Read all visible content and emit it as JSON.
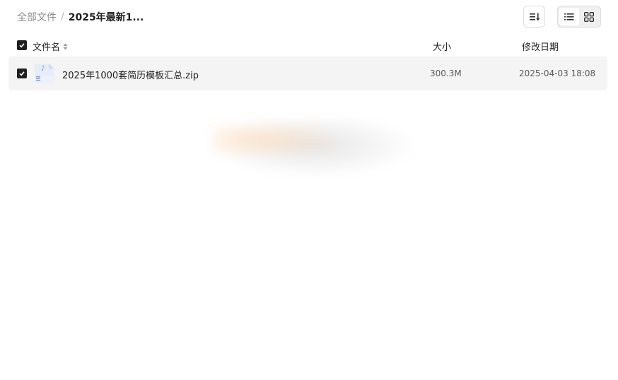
{
  "breadcrumb": {
    "root": "全部文件",
    "separator": "/",
    "current": "2025年最新1..."
  },
  "toolbar": {
    "sort_icon": "sort-list-icon",
    "view_list_icon": "list-view-icon",
    "view_grid_icon": "grid-view-icon",
    "active_view": "list"
  },
  "table": {
    "header": {
      "name": "文件名",
      "size": "大小",
      "modified": "修改日期"
    },
    "rows": [
      {
        "name": "2025年1000套简历模板汇总.zip",
        "size": "300.3M",
        "modified": "2025-04-03 18:08",
        "selected": true,
        "icon": "zip-file-icon"
      }
    ]
  },
  "colors": {
    "accent": "#1f1f1f",
    "row_bg": "#f4f4f4",
    "muted": "#8c8c8c"
  }
}
